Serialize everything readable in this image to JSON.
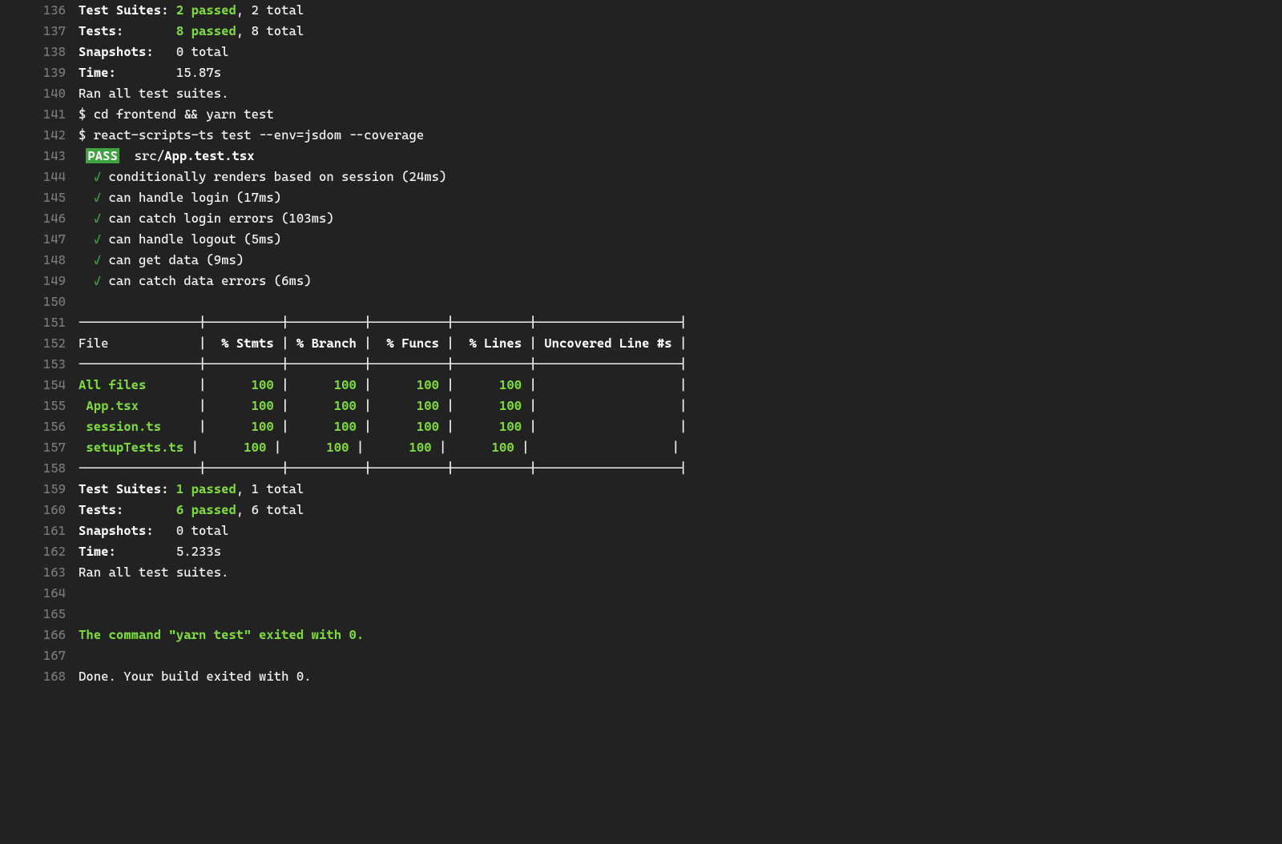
{
  "startLine": 136,
  "colors": {
    "green": "#7fdb3d",
    "passBg": "#3fa33f",
    "lineno": "#777777",
    "bg": "#222222"
  },
  "lines": [
    {
      "n": 136,
      "segs": [
        {
          "t": "Test Suites: ",
          "cls": "bold"
        },
        {
          "t": "2 passed",
          "cls": "green-bold"
        },
        {
          "t": ", 2 total",
          "cls": ""
        }
      ]
    },
    {
      "n": 137,
      "segs": [
        {
          "t": "Tests:       ",
          "cls": "bold"
        },
        {
          "t": "8 passed",
          "cls": "green-bold"
        },
        {
          "t": ", 8 total",
          "cls": ""
        }
      ]
    },
    {
      "n": 138,
      "segs": [
        {
          "t": "Snapshots:   ",
          "cls": "bold"
        },
        {
          "t": "0 total",
          "cls": ""
        }
      ]
    },
    {
      "n": 139,
      "segs": [
        {
          "t": "Time:        ",
          "cls": "bold"
        },
        {
          "t": "15.87s",
          "cls": ""
        }
      ]
    },
    {
      "n": 140,
      "segs": [
        {
          "t": "Ran all test suites.",
          "cls": ""
        }
      ]
    },
    {
      "n": 141,
      "segs": [
        {
          "t": "$ cd frontend && yarn test",
          "cls": ""
        }
      ]
    },
    {
      "n": 142,
      "segs": [
        {
          "t": "$ react-scripts-ts test --env=jsdom --coverage",
          "cls": ""
        }
      ]
    },
    {
      "n": 143,
      "segs": [
        {
          "t": " ",
          "cls": ""
        },
        {
          "t": "PASS",
          "cls": "pass-badge"
        },
        {
          "t": "  ",
          "cls": ""
        },
        {
          "t": "src/",
          "cls": ""
        },
        {
          "t": "App.test.tsx",
          "cls": "bold"
        }
      ]
    },
    {
      "n": 144,
      "segs": [
        {
          "t": "  ",
          "cls": ""
        },
        {
          "t": "✓",
          "cls": "check"
        },
        {
          "t": " conditionally renders based on session (24ms)",
          "cls": ""
        }
      ]
    },
    {
      "n": 145,
      "segs": [
        {
          "t": "  ",
          "cls": ""
        },
        {
          "t": "✓",
          "cls": "check"
        },
        {
          "t": " can handle login (17ms)",
          "cls": ""
        }
      ]
    },
    {
      "n": 146,
      "segs": [
        {
          "t": "  ",
          "cls": ""
        },
        {
          "t": "✓",
          "cls": "check"
        },
        {
          "t": " can catch login errors (103ms)",
          "cls": ""
        }
      ]
    },
    {
      "n": 147,
      "segs": [
        {
          "t": "  ",
          "cls": ""
        },
        {
          "t": "✓",
          "cls": "check"
        },
        {
          "t": " can handle logout (5ms)",
          "cls": ""
        }
      ]
    },
    {
      "n": 148,
      "segs": [
        {
          "t": "  ",
          "cls": ""
        },
        {
          "t": "✓",
          "cls": "check"
        },
        {
          "t": " can get data (9ms)",
          "cls": ""
        }
      ]
    },
    {
      "n": 149,
      "segs": [
        {
          "t": "  ",
          "cls": ""
        },
        {
          "t": "✓",
          "cls": "check"
        },
        {
          "t": " can catch data errors (6ms)",
          "cls": ""
        }
      ]
    },
    {
      "n": 150,
      "segs": [
        {
          "t": "",
          "cls": ""
        }
      ]
    },
    {
      "n": 151,
      "segs": [
        {
          "t": "----------------|----------|----------|----------|----------|-------------------|",
          "cls": ""
        }
      ]
    },
    {
      "n": 152,
      "segs": [
        {
          "t": "File            | ",
          "cls": ""
        },
        {
          "t": " % Stmts ",
          "cls": "bold"
        },
        {
          "t": "| ",
          "cls": ""
        },
        {
          "t": "% Branch ",
          "cls": "bold"
        },
        {
          "t": "| ",
          "cls": ""
        },
        {
          "t": " % Funcs ",
          "cls": "bold"
        },
        {
          "t": "| ",
          "cls": ""
        },
        {
          "t": " % Lines ",
          "cls": "bold"
        },
        {
          "t": "| ",
          "cls": ""
        },
        {
          "t": "Uncovered Line #s ",
          "cls": "bold"
        },
        {
          "t": "|",
          "cls": ""
        }
      ]
    },
    {
      "n": 153,
      "segs": [
        {
          "t": "----------------|----------|----------|----------|----------|-------------------|",
          "cls": ""
        }
      ]
    },
    {
      "n": 154,
      "segs": [
        {
          "t": "All files      ",
          "cls": "green-bold"
        },
        {
          "t": " | ",
          "cls": ""
        },
        {
          "t": "     100 ",
          "cls": "green-bold"
        },
        {
          "t": "| ",
          "cls": ""
        },
        {
          "t": "     100 ",
          "cls": "green-bold"
        },
        {
          "t": "| ",
          "cls": ""
        },
        {
          "t": "     100 ",
          "cls": "green-bold"
        },
        {
          "t": "| ",
          "cls": ""
        },
        {
          "t": "     100 ",
          "cls": "green-bold"
        },
        {
          "t": "|                   |",
          "cls": ""
        }
      ]
    },
    {
      "n": 155,
      "segs": [
        {
          "t": " App.tsx       ",
          "cls": "green-bold"
        },
        {
          "t": " | ",
          "cls": ""
        },
        {
          "t": "     100 ",
          "cls": "green-bold"
        },
        {
          "t": "| ",
          "cls": ""
        },
        {
          "t": "     100 ",
          "cls": "green-bold"
        },
        {
          "t": "| ",
          "cls": ""
        },
        {
          "t": "     100 ",
          "cls": "green-bold"
        },
        {
          "t": "| ",
          "cls": ""
        },
        {
          "t": "     100 ",
          "cls": "green-bold"
        },
        {
          "t": "|                   |",
          "cls": ""
        }
      ]
    },
    {
      "n": 156,
      "segs": [
        {
          "t": " session.ts    ",
          "cls": "green-bold"
        },
        {
          "t": " | ",
          "cls": ""
        },
        {
          "t": "     100 ",
          "cls": "green-bold"
        },
        {
          "t": "| ",
          "cls": ""
        },
        {
          "t": "     100 ",
          "cls": "green-bold"
        },
        {
          "t": "| ",
          "cls": ""
        },
        {
          "t": "     100 ",
          "cls": "green-bold"
        },
        {
          "t": "| ",
          "cls": ""
        },
        {
          "t": "     100 ",
          "cls": "green-bold"
        },
        {
          "t": "|                   |",
          "cls": ""
        }
      ]
    },
    {
      "n": 157,
      "segs": [
        {
          "t": " setupTests.ts ",
          "cls": "green-bold"
        },
        {
          "t": "| ",
          "cls": ""
        },
        {
          "t": "     100 ",
          "cls": "green-bold"
        },
        {
          "t": "| ",
          "cls": ""
        },
        {
          "t": "     100 ",
          "cls": "green-bold"
        },
        {
          "t": "| ",
          "cls": ""
        },
        {
          "t": "     100 ",
          "cls": "green-bold"
        },
        {
          "t": "| ",
          "cls": ""
        },
        {
          "t": "     100 ",
          "cls": "green-bold"
        },
        {
          "t": "|                   |",
          "cls": ""
        }
      ]
    },
    {
      "n": 158,
      "segs": [
        {
          "t": "----------------|----------|----------|----------|----------|-------------------|",
          "cls": ""
        }
      ]
    },
    {
      "n": 159,
      "segs": [
        {
          "t": "Test Suites: ",
          "cls": "bold"
        },
        {
          "t": "1 passed",
          "cls": "green-bold"
        },
        {
          "t": ", 1 total",
          "cls": ""
        }
      ]
    },
    {
      "n": 160,
      "segs": [
        {
          "t": "Tests:       ",
          "cls": "bold"
        },
        {
          "t": "6 passed",
          "cls": "green-bold"
        },
        {
          "t": ", 6 total",
          "cls": ""
        }
      ]
    },
    {
      "n": 161,
      "segs": [
        {
          "t": "Snapshots:   ",
          "cls": "bold"
        },
        {
          "t": "0 total",
          "cls": ""
        }
      ]
    },
    {
      "n": 162,
      "segs": [
        {
          "t": "Time:        ",
          "cls": "bold"
        },
        {
          "t": "5.233s",
          "cls": ""
        }
      ]
    },
    {
      "n": 163,
      "segs": [
        {
          "t": "Ran all test suites.",
          "cls": ""
        }
      ]
    },
    {
      "n": 164,
      "segs": [
        {
          "t": "",
          "cls": ""
        }
      ]
    },
    {
      "n": 165,
      "segs": [
        {
          "t": "",
          "cls": ""
        }
      ]
    },
    {
      "n": 166,
      "segs": [
        {
          "t": "The command \"yarn test\" exited with 0.",
          "cls": "green-bold"
        }
      ]
    },
    {
      "n": 167,
      "segs": [
        {
          "t": "",
          "cls": ""
        }
      ]
    },
    {
      "n": 168,
      "segs": [
        {
          "t": "Done. Your build exited with 0.",
          "cls": ""
        }
      ]
    }
  ]
}
